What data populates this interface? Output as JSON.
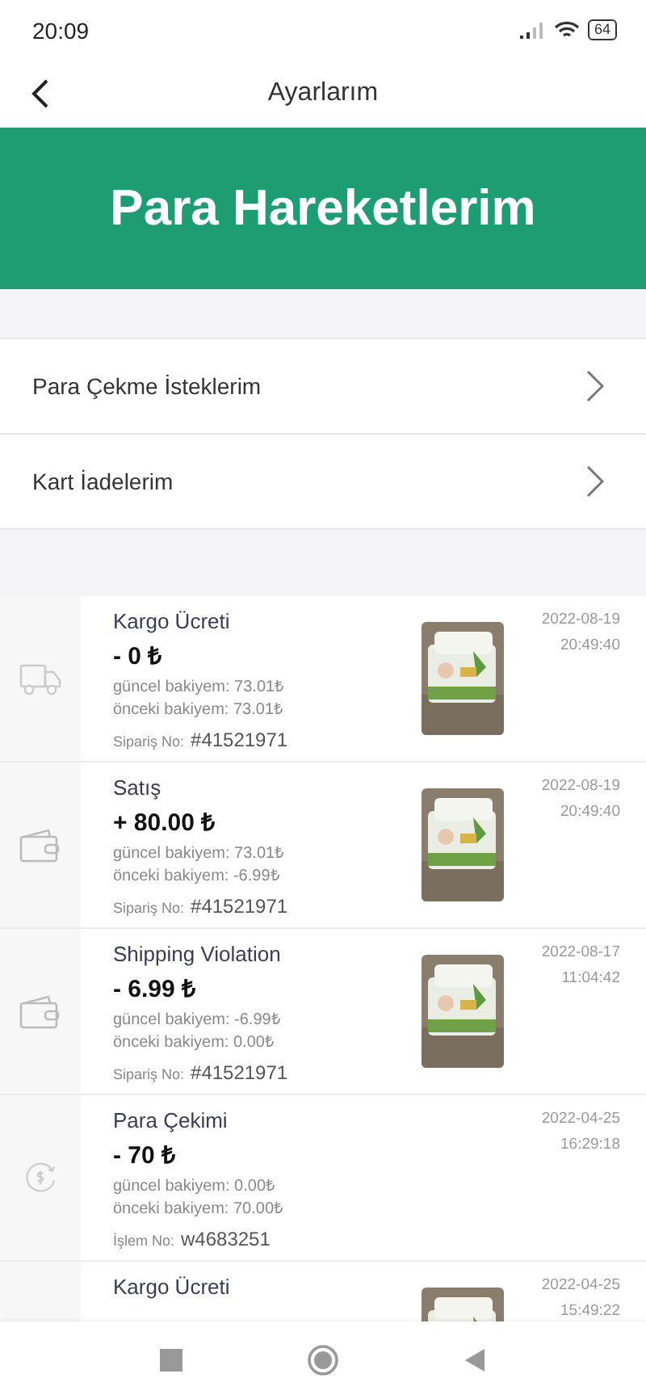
{
  "status_bar": {
    "time": "20:09",
    "battery": "64"
  },
  "header": {
    "title": "Ayarlarım"
  },
  "banner": {
    "title": "Para Hareketlerim"
  },
  "menu": [
    {
      "label": "Para Çekme İsteklerim"
    },
    {
      "label": "Kart İadelerim"
    }
  ],
  "transactions": [
    {
      "kind": "truck",
      "title": "Kargo Ücreti",
      "amount": "- 0 ₺",
      "current": "güncel bakiyem: 73.01₺",
      "previous": "önceki bakiyem: 73.01₺",
      "ref_label": "Sipariş No:",
      "ref": "#41521971",
      "date": "2022-08-19",
      "time": "20:49:40"
    },
    {
      "kind": "wallet",
      "title": "Satış",
      "amount": "+ 80.00 ₺",
      "current": "güncel bakiyem: 73.01₺",
      "previous": "önceki bakiyem: -6.99₺",
      "ref_label": "Sipariş No:",
      "ref": "#41521971",
      "date": "2022-08-19",
      "time": "20:49:40"
    },
    {
      "kind": "wallet",
      "title": "Shipping Violation",
      "amount": "- 6.99 ₺",
      "current": "güncel bakiyem: -6.99₺",
      "previous": "önceki bakiyem: 0.00₺",
      "ref_label": "Sipariş No:",
      "ref": "#41521971",
      "date": "2022-08-17",
      "time": "11:04:42"
    },
    {
      "kind": "dollar",
      "title": "Para Çekimi",
      "amount": "- 70 ₺",
      "current": "güncel bakiyem: 0.00₺",
      "previous": "önceki bakiyem: 70.00₺",
      "ref_label": "İşlem No:",
      "ref": "w4683251",
      "date": "2022-04-25",
      "time": "16:29:18"
    },
    {
      "title": "Kargo Ücreti",
      "date": "2022-04-25",
      "time": "15:49:22"
    }
  ]
}
